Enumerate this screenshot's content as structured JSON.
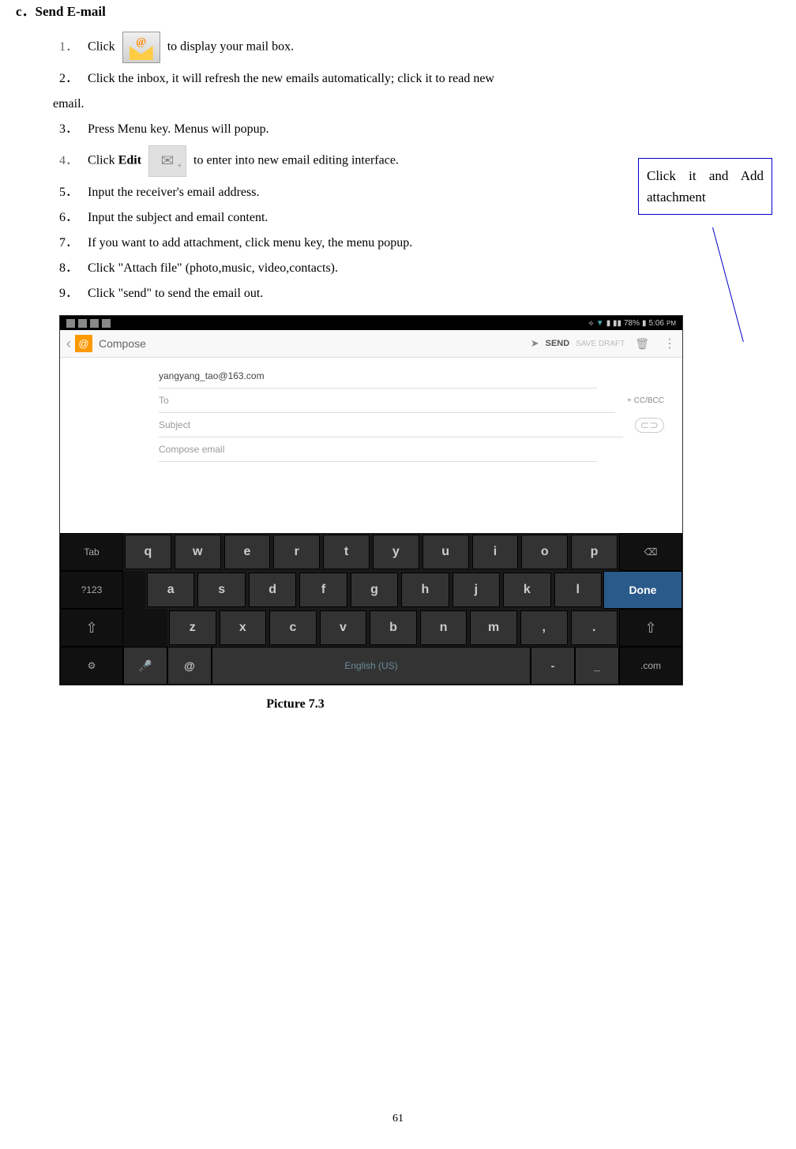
{
  "section": {
    "letter": "c．",
    "title": "Send E-mail"
  },
  "steps": [
    {
      "num": "1．",
      "before": "Click",
      "after": " to display your mail box.",
      "icon": "mail"
    },
    {
      "num": "2．",
      "text": "Click the inbox, it will refresh the new emails automatically; click it to read new",
      "cont": "email."
    },
    {
      "num": "3．",
      "text": "Press Menu key. Menus will popup."
    },
    {
      "num": "4．",
      "before": "Click ",
      "bold": "Edit",
      "after": " to enter into new email editing interface.",
      "icon": "edit"
    },
    {
      "num": "5．",
      "text": "Input the receiver's email address."
    },
    {
      "num": "6．",
      "text": "Input the subject and email content."
    },
    {
      "num": "7．",
      "text": "If you want to add attachment, click menu key, the menu popup."
    },
    {
      "num": "8．",
      "text": "Click \"Attach file\" (photo,music, video,contacts)."
    },
    {
      "num": "9．",
      "text": "Click \"send\" to send the email out."
    }
  ],
  "callout": "Click it and Add attachment",
  "screenshot": {
    "status": {
      "battery": "78%",
      "time": "5:06"
    },
    "header": {
      "title": "Compose",
      "send": "SEND",
      "save_draft": "SAVE DRAFT"
    },
    "form": {
      "from": "yangyang_tao@163.com",
      "to_placeholder": "To",
      "cc_bcc": "+ CC/BCC",
      "subject_placeholder": "Subject",
      "body_placeholder": "Compose email"
    },
    "keyboard": {
      "tab": "Tab",
      "row1": [
        "q",
        "w",
        "e",
        "r",
        "t",
        "y",
        "u",
        "i",
        "o",
        "p"
      ],
      "backspace": "⌫",
      "sym": "?123",
      "row2": [
        "a",
        "s",
        "d",
        "f",
        "g",
        "h",
        "j",
        "k",
        "l"
      ],
      "done": "Done",
      "shift": "⇧",
      "row3": [
        "z",
        "x",
        "c",
        "v",
        "b",
        "n",
        "m",
        ",",
        "."
      ],
      "globe": "⚙",
      "mic": "🎤",
      "at": "@",
      "space": "English (US)",
      "dash": "-",
      "underscore": "_",
      "com": ".com"
    }
  },
  "caption": "Picture 7.3",
  "page_number": "61"
}
